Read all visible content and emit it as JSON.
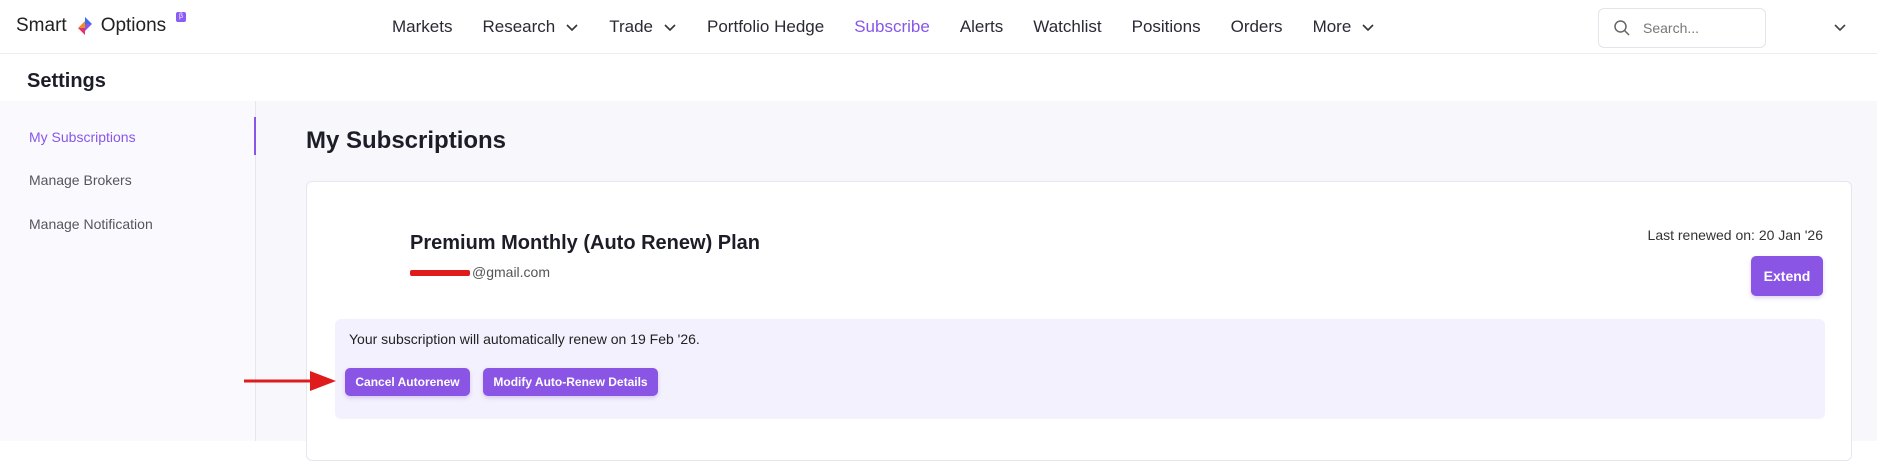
{
  "brand": {
    "name_left": "Smart",
    "name_right": "Options",
    "badge": "β"
  },
  "nav": {
    "items": [
      {
        "label": "Markets",
        "dropdown": false
      },
      {
        "label": "Research",
        "dropdown": true
      },
      {
        "label": "Trade",
        "dropdown": true
      },
      {
        "label": "Portfolio Hedge",
        "dropdown": false
      },
      {
        "label": "Subscribe",
        "dropdown": false,
        "active": true
      },
      {
        "label": "Alerts",
        "dropdown": false
      },
      {
        "label": "Watchlist",
        "dropdown": false
      },
      {
        "label": "Positions",
        "dropdown": false
      },
      {
        "label": "Orders",
        "dropdown": false
      },
      {
        "label": "More",
        "dropdown": true
      }
    ],
    "search_placeholder": "Search..."
  },
  "settings": {
    "title": "Settings",
    "sidebar": [
      {
        "label": "My Subscriptions",
        "active": true
      },
      {
        "label": "Manage Brokers",
        "active": false
      },
      {
        "label": "Manage Notification",
        "active": false
      }
    ]
  },
  "main": {
    "title": "My Subscriptions",
    "subscription": {
      "plan_name": "Premium Monthly (Auto Renew) Plan",
      "email_suffix": "@gmail.com",
      "last_renewed": "Last renewed on: 20 Jan '26",
      "extend_label": "Extend",
      "renew_message": "Your subscription will automatically renew on 19 Feb '26.",
      "cancel_label": "Cancel Autorenew",
      "modify_label": "Modify Auto-Renew Details"
    }
  },
  "colors": {
    "accent": "#8857e8",
    "button": "#8a55e4",
    "annotation_arrow": "#e01b1b"
  }
}
